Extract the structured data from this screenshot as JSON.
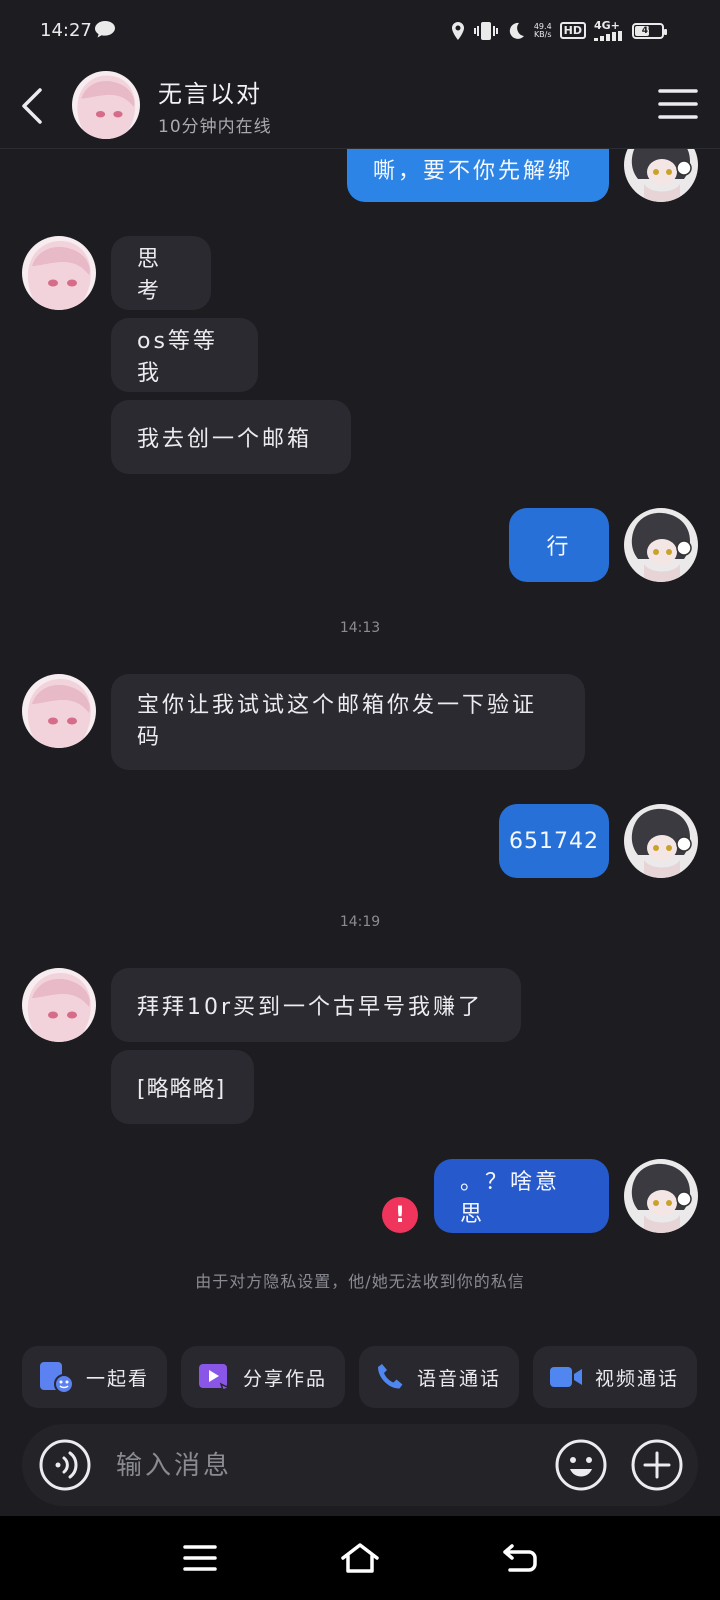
{
  "status_bar": {
    "time": "14:27",
    "net_speed_value": "49.4",
    "net_speed_unit": "KB/s",
    "hd_label": "HD",
    "network_label": "4G+",
    "battery_level": "49"
  },
  "header": {
    "contact_name": "无言以对",
    "online_status": "10分钟内在线"
  },
  "messages": [
    {
      "direction": "out",
      "text": "嘶，要不你先解绑"
    },
    {
      "direction": "in",
      "text": "思考"
    },
    {
      "direction": "in",
      "text": "os等等我"
    },
    {
      "direction": "in",
      "text": "我去创一个邮箱"
    },
    {
      "direction": "out",
      "text": "行"
    },
    {
      "direction": "in",
      "text": "宝你让我试试这个邮箱你发一下验证码"
    },
    {
      "direction": "out",
      "text": "651742"
    },
    {
      "direction": "in",
      "text": "拜拜10r买到一个古早号我赚了"
    },
    {
      "direction": "in",
      "text": "[略略略]"
    },
    {
      "direction": "out",
      "text": "。？啥意思",
      "failed": true
    }
  ],
  "time_dividers": [
    "14:13",
    "14:19"
  ],
  "error_badge": "!",
  "system_note": "由于对方隐私设置，他/她无法收到你的私信",
  "quick_actions": [
    {
      "label": "一起看",
      "icon": "watch-together-icon"
    },
    {
      "label": "分享作品",
      "icon": "share-video-icon"
    },
    {
      "label": "语音通话",
      "icon": "phone-icon"
    },
    {
      "label": "视频通话",
      "icon": "video-camera-icon"
    }
  ],
  "input": {
    "placeholder": "输入消息",
    "value": ""
  },
  "colors": {
    "background": "#1c1c21",
    "incoming_bubble": "#2a2a30",
    "outgoing_bubble": "#2670d8",
    "error": "#f0355c"
  }
}
